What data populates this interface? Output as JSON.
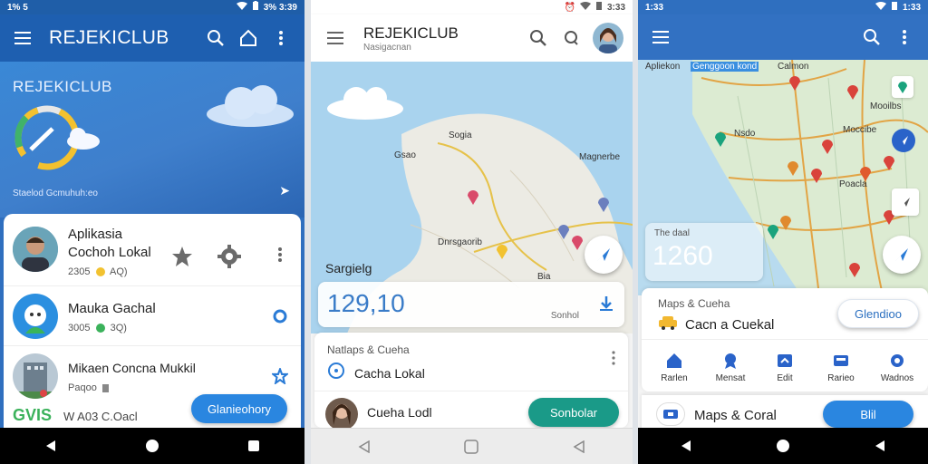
{
  "phone1": {
    "status": {
      "time": "1% 5",
      "right": "3% 3:39"
    },
    "app_title": "REJEKICLUB",
    "hero": {
      "title": "REJEKICLUB",
      "subtitle": "Staelod Gcmuhuh:eo"
    },
    "items": [
      {
        "title_line1": "Aplikasia",
        "title_line2": "Cochoh Lokal",
        "sub": "2305",
        "sub2": "AQ)"
      },
      {
        "title": "Mauka Gachal",
        "sub": "3005",
        "sub2": "3Q)"
      },
      {
        "title": "Mikaen Concna Mukkil",
        "sub": "Paqoo"
      }
    ],
    "footer_left": "GVIS",
    "footer_text": "W A03 C.Oacl",
    "pill_label": "Glanieohory"
  },
  "phone2": {
    "status": {
      "right": "3:33"
    },
    "app_title": "REJEKICLUB",
    "app_sub": "Nasigacnan",
    "map_labels": {
      "a": "Sogia",
      "b": "Gsao",
      "c": "Magnerbe",
      "d": "Dnrsgaorib",
      "e": "Bia"
    },
    "sargielg": "Sargielg",
    "stat_value": "129,10",
    "stat_caption": "Sonhol",
    "sheet_header": "Natlaps & Cueha",
    "sheet_item": "Cacha Lokal",
    "sheet_item2": "Cueha Lodl",
    "pill_label": "Sonbolar"
  },
  "phone3": {
    "status": {
      "time": "1:33",
      "right": "1:33"
    },
    "map_labels": {
      "a": "Apliekon",
      "b": "Genggoon kond",
      "c": "Calmon",
      "d": "Nsdo",
      "e": "Moccibe",
      "f": "Mooilbs",
      "g": "Poacla"
    },
    "stat_title": "The daal",
    "stat_value": "1260",
    "sheet_header": "Maps & Cueha",
    "sheet_item": "Cacn a Cuekal",
    "sheet_button": "Glendioo",
    "categories": [
      "Rarlen",
      "Mensat",
      "Edit",
      "Rarieo",
      "Wadnos"
    ],
    "bottom_item": "Maps & Coral",
    "bottom_button": "Blil"
  },
  "colors": {
    "primary": "#1e5fb0",
    "accent_teal": "#1a9a88",
    "pill_blue": "#2a86e0"
  }
}
